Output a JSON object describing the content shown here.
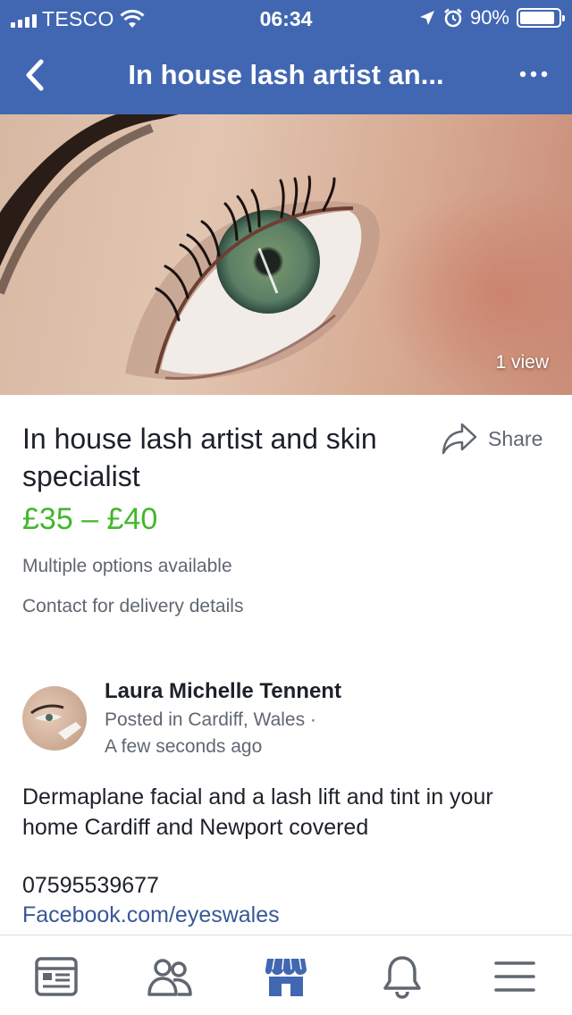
{
  "status_bar": {
    "carrier": "TESCO",
    "time": "06:34",
    "battery": "90%"
  },
  "nav": {
    "title": "In house lash artist an..."
  },
  "hero": {
    "views": "1 view"
  },
  "listing": {
    "title": "In house lash artist and skin specialist",
    "share_label": "Share",
    "price": "£35 – £40",
    "options": "Multiple options available",
    "delivery": "Contact for delivery details"
  },
  "seller": {
    "name": "Laura Michelle Tennent",
    "location": "Posted in Cardiff, Wales ·",
    "time": "A few seconds ago"
  },
  "description": {
    "text": "Dermaplane facial and a lash lift and tint in your home Cardiff and Newport covered",
    "phone": "07595539677",
    "link": "Facebook.com/eyeswales"
  },
  "tabs": [
    {
      "icon": "news-feed-icon",
      "active": false
    },
    {
      "icon": "groups-icon",
      "active": false
    },
    {
      "icon": "marketplace-icon",
      "active": true
    },
    {
      "icon": "notifications-icon",
      "active": false
    },
    {
      "icon": "menu-icon",
      "active": false
    }
  ],
  "colors": {
    "brand": "#4267b2",
    "price": "#42b72a",
    "link": "#385898",
    "secondary_text": "#606770"
  }
}
